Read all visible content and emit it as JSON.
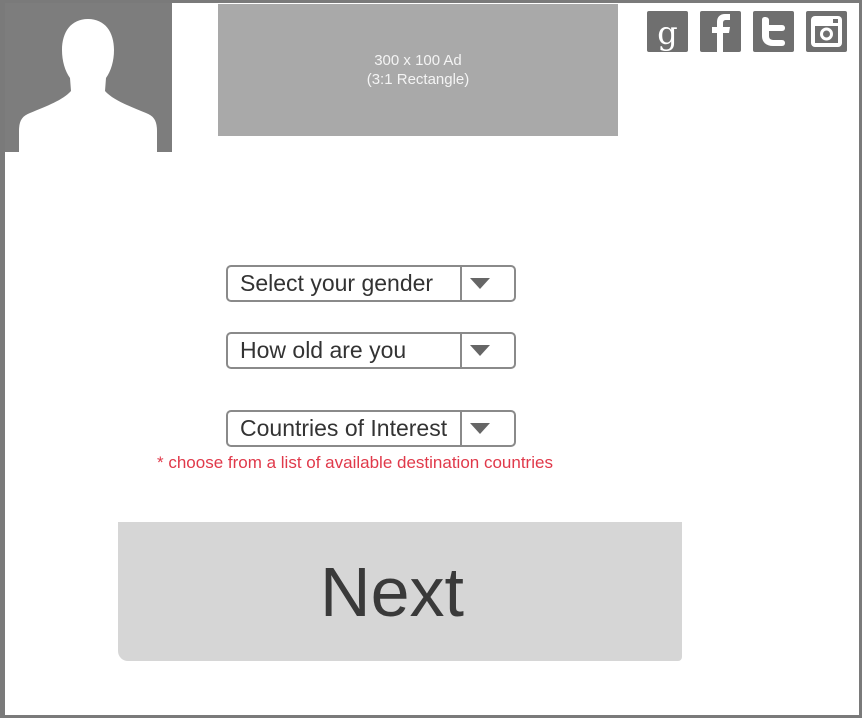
{
  "ad": {
    "line1": "300 x 100 Ad",
    "line2": "(3:1 Rectangle)"
  },
  "social": [
    {
      "name": "google-icon"
    },
    {
      "name": "facebook-icon"
    },
    {
      "name": "twitter-icon"
    },
    {
      "name": "instagram-icon"
    }
  ],
  "form": {
    "gender_label": "Select your gender",
    "age_label": "How old are you",
    "countries_label": "Countries of Interest",
    "countries_hint": "* choose from a list of available destination countries"
  },
  "actions": {
    "next_label": "Next"
  },
  "colors": {
    "placeholder_dark": "#7d7d7d",
    "ad_bg": "#a9a9a9",
    "hint": "#e0394a",
    "button_bg": "#d6d6d6"
  }
}
